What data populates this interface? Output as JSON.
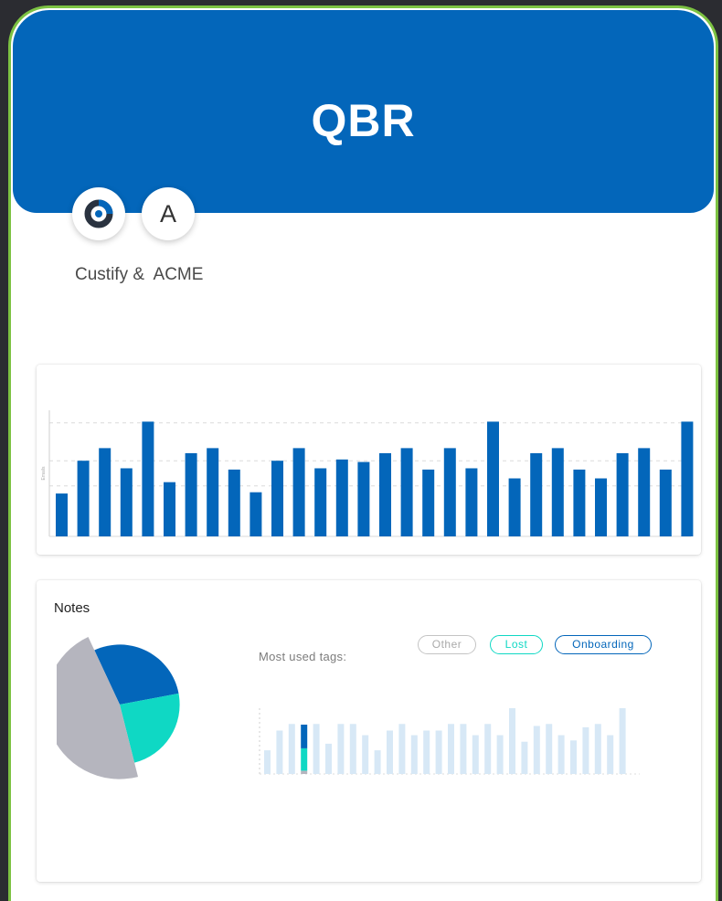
{
  "header": {
    "title": "QBR"
  },
  "participants": {
    "logos": [
      {
        "icon": "custify-logo-icon"
      },
      {
        "initial": "A"
      }
    ],
    "label": "Custify &  ACME"
  },
  "colors": {
    "brand_blue": "#0366ba",
    "frame_green": "#7cc242",
    "teal": "#0fd8c4",
    "gray": "#b5b5be",
    "light_bar": "#d7e8f6"
  },
  "chart_data": [
    {
      "type": "bar",
      "ylabel": "Emails",
      "grid": true,
      "ylim": [
        0,
        100
      ],
      "values": [
        34,
        60,
        70,
        54,
        91,
        43,
        66,
        70,
        53,
        35,
        60,
        70,
        54,
        61,
        59,
        66,
        70,
        53,
        70,
        54,
        91,
        46,
        66,
        70,
        53,
        46,
        66,
        70,
        53,
        91
      ]
    },
    {
      "type": "pie",
      "series": [
        {
          "label": "Onboarding",
          "value": 29,
          "color": "#0366ba"
        },
        {
          "label": "Lost",
          "value": 24,
          "color": "#0fd8c4"
        },
        {
          "label": "Other",
          "value": 47,
          "color": "#b5b5be"
        }
      ]
    },
    {
      "type": "bar",
      "legend": [
        "Other",
        "Lost",
        "Onboarding"
      ],
      "values": [
        36,
        66,
        76,
        59,
        76,
        46,
        76,
        76,
        59,
        36,
        66,
        76,
        59,
        66,
        66,
        76,
        76,
        59,
        76,
        59,
        100,
        49,
        73,
        76,
        59,
        51,
        71,
        76,
        59,
        100
      ],
      "highlighted_bar": {
        "index": 3,
        "onboarding": 36,
        "lost": 34,
        "other": 5
      }
    }
  ],
  "notes": {
    "title": "Notes",
    "tags_label": "Most used tags:",
    "tags": [
      {
        "label": "Other",
        "color": "#bdbdbd"
      },
      {
        "label": "Lost",
        "color": "#0fd8c4"
      },
      {
        "label": "Onboarding",
        "color": "#0366ba"
      }
    ]
  }
}
